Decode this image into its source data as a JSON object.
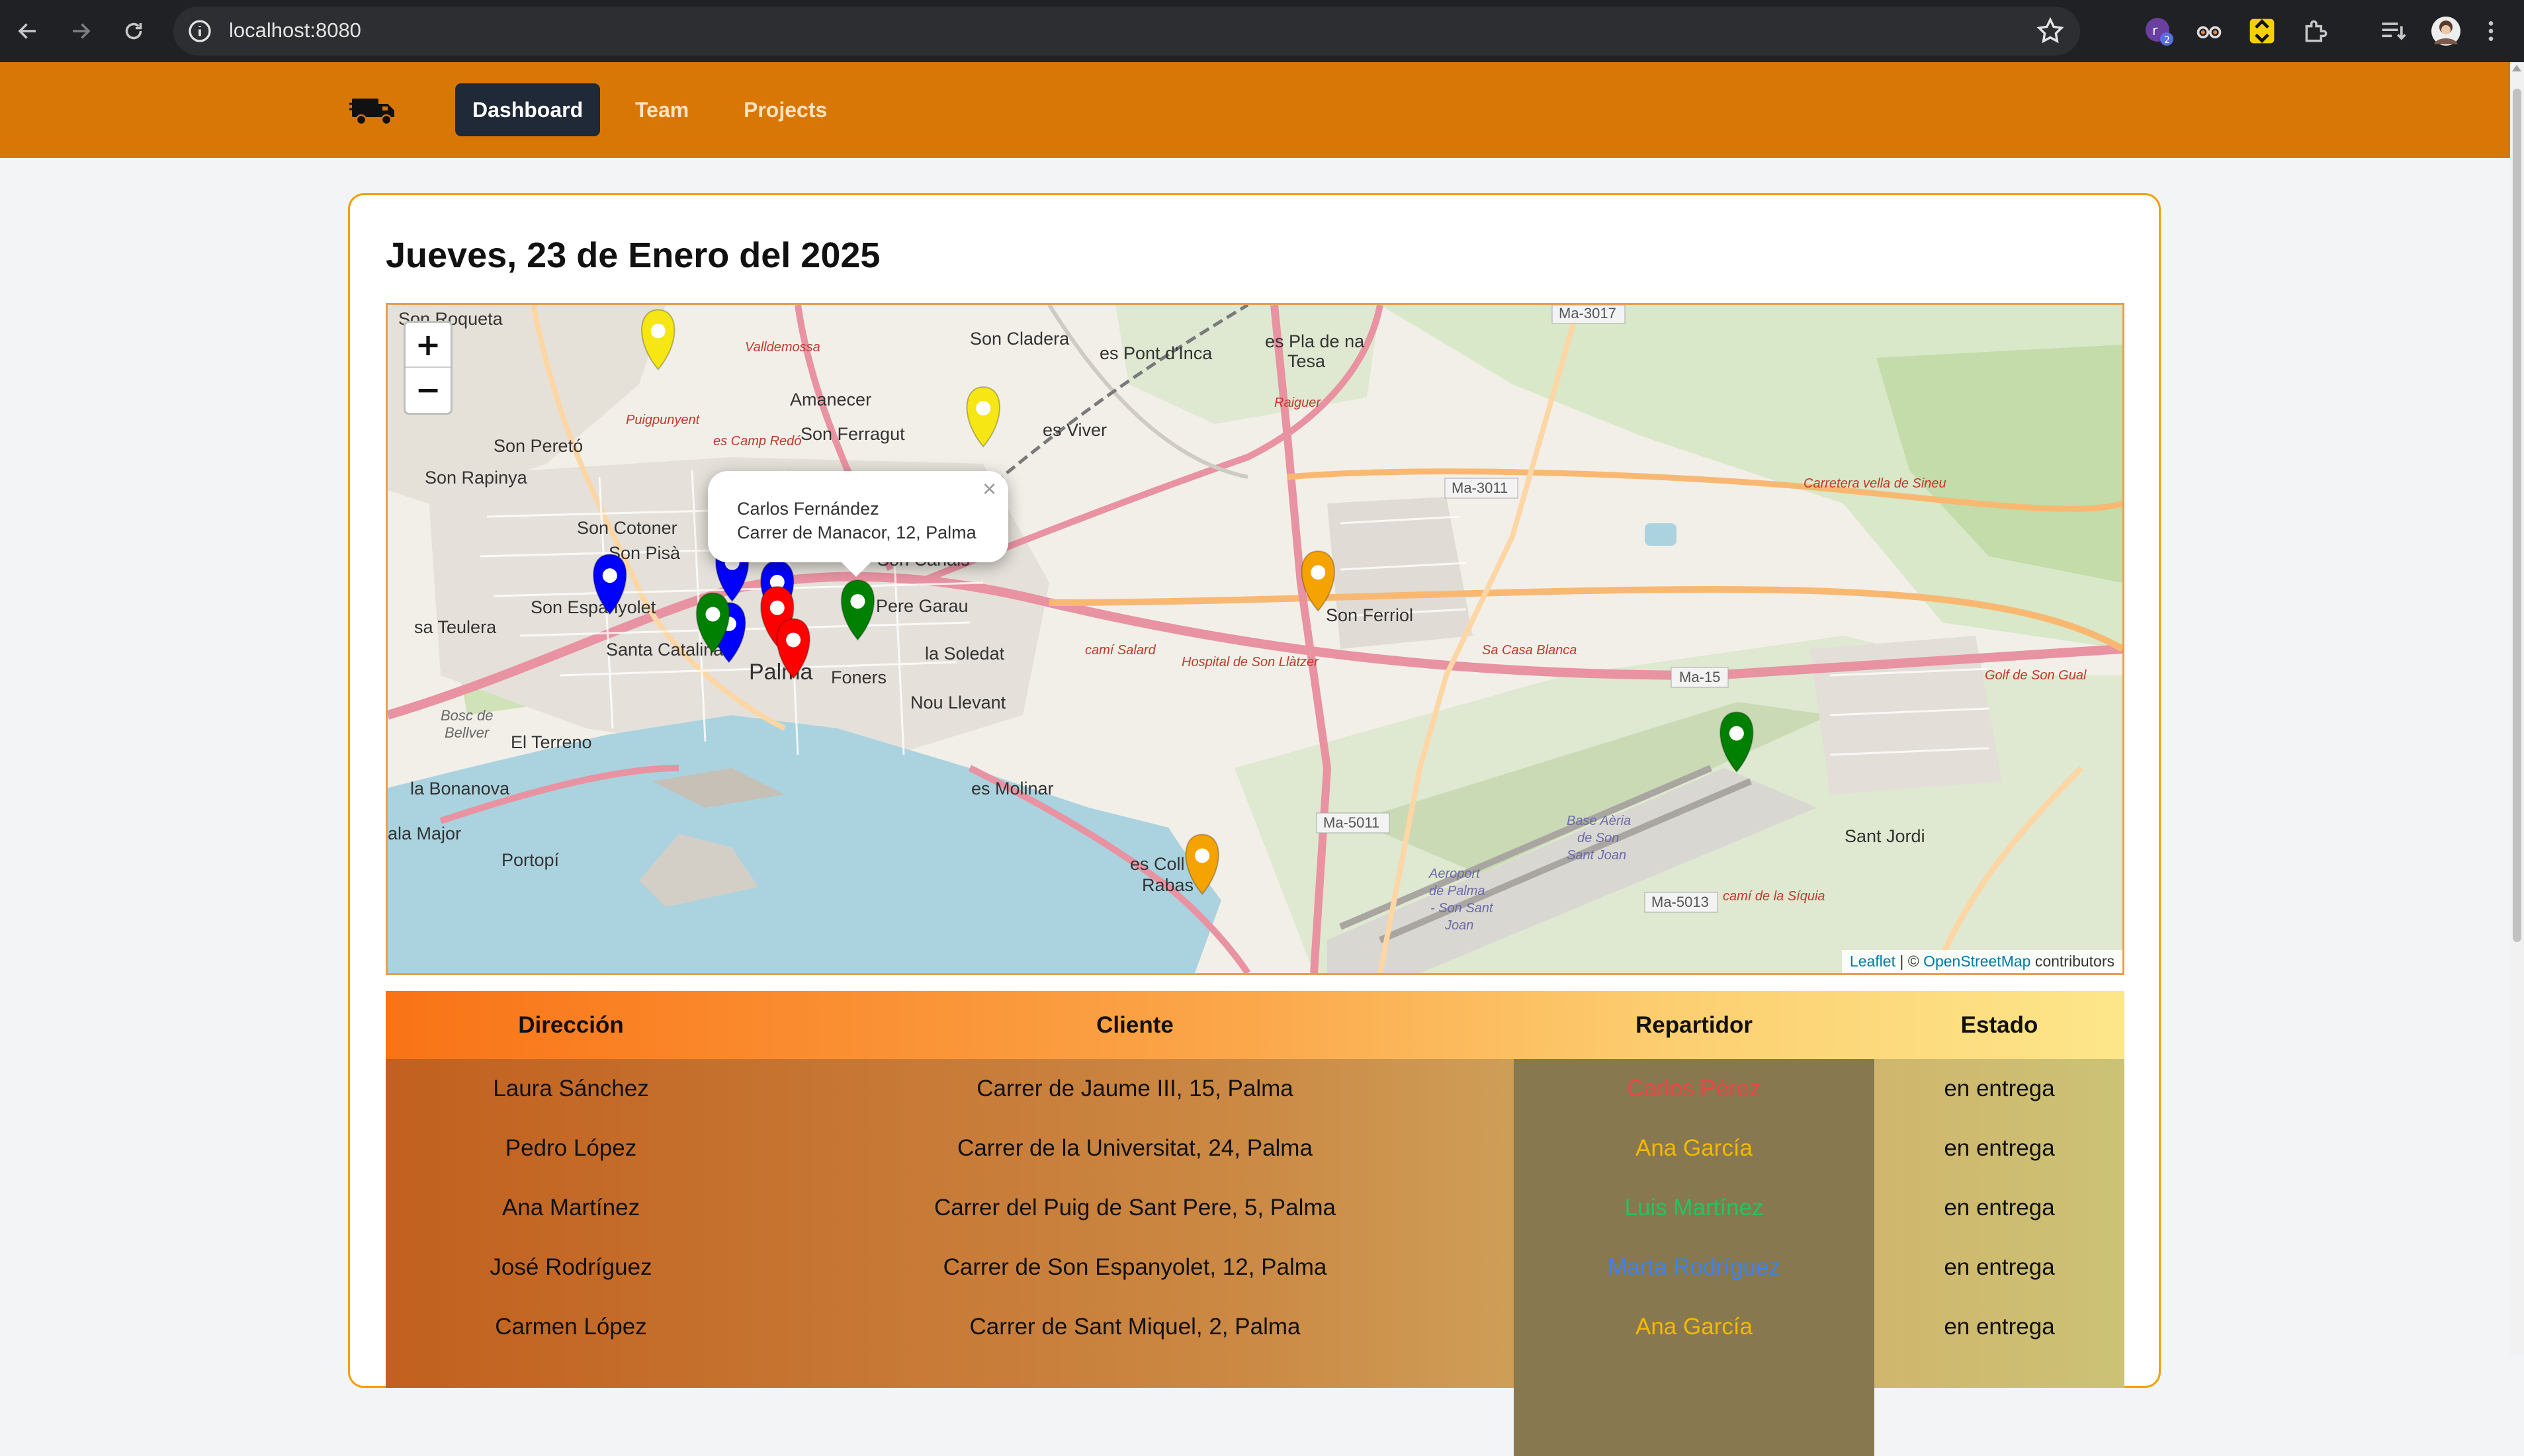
{
  "browser": {
    "url": "localhost:8080",
    "back_icon": "arrow-left-icon",
    "forward_icon": "arrow-right-icon",
    "reload_icon": "reload-icon"
  },
  "navbar": {
    "logo": "truck-icon",
    "links": [
      {
        "label": "Dashboard",
        "active": true
      },
      {
        "label": "Team",
        "active": false
      },
      {
        "label": "Projects",
        "active": false
      }
    ],
    "color": "#d97706"
  },
  "page": {
    "title": "Jueves, 23 de Enero del 2025"
  },
  "map": {
    "zoom_in": "+",
    "zoom_out": "−",
    "popup": {
      "name": "Carlos Fernández",
      "address": "Carrer de Manacor, 12, Palma",
      "close": "×"
    },
    "attribution": {
      "leaflet": "Leaflet",
      "sep": "| ©",
      "osm": "OpenStreetMap",
      "suffix": "contributors"
    },
    "labels": {
      "son_roqueta": "Son Roqueta",
      "son_cladera": "Son Cladera",
      "es_pont_dinca": "es Pont d'Inca",
      "es_pla_de_na_tesa_1": "es Pla de na",
      "es_pla_de_na_tesa_2": "Tesa",
      "amanecer": "Amanecer",
      "son_ferragut": "Son Ferragut",
      "es_viver": "es Viver",
      "son_perello": "Son Peretó",
      "son_rapinya": "Son Rapinya",
      "son_cotoner": "Son Cotoner",
      "son_pisa": "Son Pisà",
      "son_espanyolet": "Son Espanyolet",
      "sa_teulera": "sa Teulera",
      "santa_catalina": "Santa Catalina",
      "son_canals": "Son Canals",
      "pere_garau": "Pere Garau",
      "la_soledat": "la Soledat",
      "foners": "Foners",
      "nou_llevant": "Nou Llevant",
      "palma": "Palma",
      "el_terreno": "El Terreno",
      "bosc_de_bellver_1": "Bosc de",
      "bosc_de_bellver_2": "Bellver",
      "la_bonanova": "la Bonanova",
      "cala_major": "ala Major",
      "portopi": "Portopí",
      "es_molinar": "es Molinar",
      "es_coll_1": "es Coll",
      "es_coll_2": "Rabas",
      "son_ferriol": "Son Ferriol",
      "sant_jordi": "Sant Jordi",
      "aeroport_1": "Aeroport",
      "aeroport_2": "de Palma",
      "aeroport_3": "- Son Sant",
      "aeroport_4": "Joan",
      "base_aerea_1": "Base Aèria",
      "base_aerea_2": "de Son",
      "base_aerea_3": "Sant Joan",
      "ma3017": "Ma-3017",
      "ma3011": "Ma-3011",
      "ma15": "Ma-15",
      "ma5011": "Ma-5011",
      "ma5013": "Ma-5013",
      "camisalard": "camí Salard",
      "hospital": "Hospital de Son Llàtzer",
      "carretera_sineu": "Carretera vella de Sineu",
      "raiguer": "Raiguer",
      "golf": "Golf de Son Gual",
      "sa_casa_blanca": "Sa Casa Blanca",
      "valldemossa": "Valldemossa",
      "puigpunyent": "Puigpunyent",
      "es_camp_redo": "es Camp Redó",
      "camt_de_la_siquia": "camí de la Síquia"
    },
    "markers": [
      {
        "color": "#f5e614",
        "label": "Son Roqueta area"
      },
      {
        "color": "#f5e614"
      },
      {
        "color": "#0000ff"
      },
      {
        "color": "#0000ff"
      },
      {
        "color": "#0000ff"
      },
      {
        "color": "#008000"
      },
      {
        "color": "#008000"
      },
      {
        "color": "#008000"
      },
      {
        "color": "#ff0000"
      },
      {
        "color": "#ff0000"
      },
      {
        "color": "#f5a300"
      },
      {
        "color": "#f5a300"
      }
    ]
  },
  "table": {
    "headers": [
      "Dirección",
      "Cliente",
      "Repartidor",
      "Estado"
    ],
    "rows": [
      {
        "direccion": "Laura Sánchez",
        "cliente": "Carrer de Jaume III, 15, Palma",
        "repartidor": "Carlos Pérez",
        "repartidor_color": "#ef4444",
        "estado": "en entrega"
      },
      {
        "direccion": "Pedro López",
        "cliente": "Carrer de la Universitat, 24, Palma",
        "repartidor": "Ana García",
        "repartidor_color": "#f5b800",
        "estado": "en entrega"
      },
      {
        "direccion": "Ana Martínez",
        "cliente": "Carrer del Puig de Sant Pere, 5, Palma",
        "repartidor": "Luis Martínez",
        "repartidor_color": "#22c55e",
        "estado": "en entrega"
      },
      {
        "direccion": "José Rodríguez",
        "cliente": "Carrer de Son Espanyolet, 12, Palma",
        "repartidor": "Marta Rodríguez",
        "repartidor_color": "#3b82f6",
        "estado": "en entrega"
      },
      {
        "direccion": "Carmen López",
        "cliente": "Carrer de Sant Miquel, 2, Palma",
        "repartidor": "Ana García",
        "repartidor_color": "#f5b800",
        "estado": "en entrega"
      }
    ]
  }
}
